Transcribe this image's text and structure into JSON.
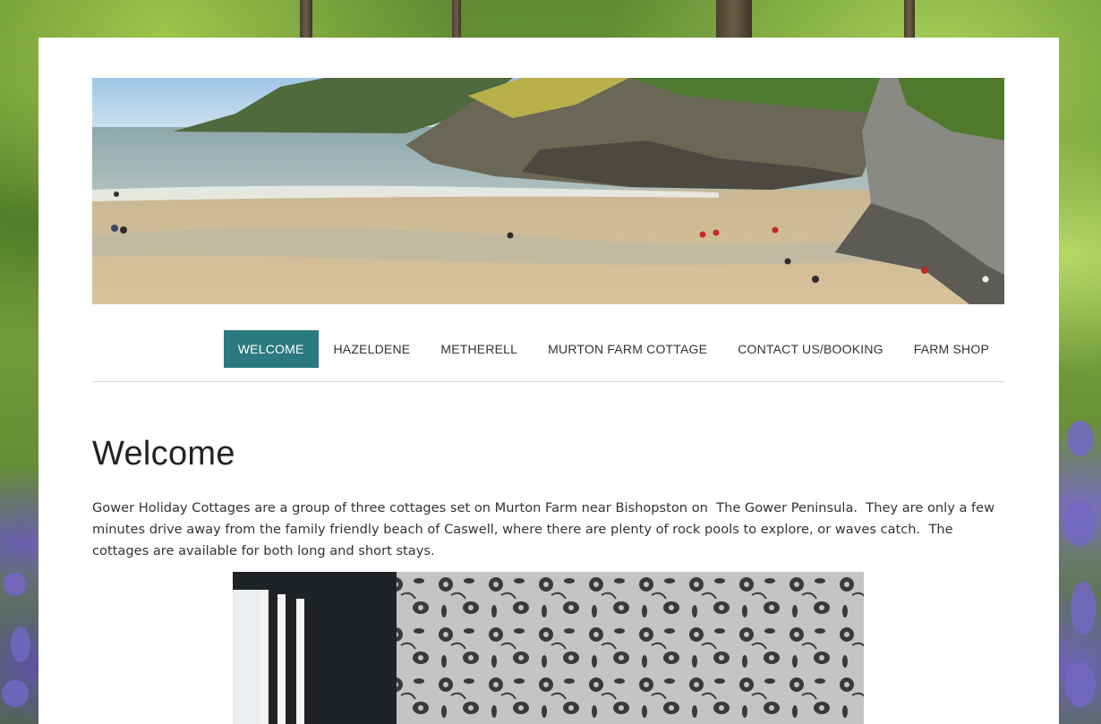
{
  "background": {
    "description_icon": "forest-bluebells-background",
    "colors": {
      "foliage": "#77a23d",
      "bluebells": "#7366c4"
    }
  },
  "banner": {
    "icon": "beach-cliffs-banner-photo"
  },
  "nav": {
    "items": [
      {
        "label": "WELCOME",
        "active": true
      },
      {
        "label": "HAZELDENE",
        "active": false
      },
      {
        "label": "METHERELL",
        "active": false
      },
      {
        "label": "MURTON FARM COTTAGE",
        "active": false
      },
      {
        "label": "CONTACT US/BOOKING",
        "active": false
      },
      {
        "label": "FARM SHOP",
        "active": false
      }
    ],
    "active_color": "#2a7a80"
  },
  "main": {
    "title": "Welcome",
    "intro": "Gower Holiday Cottages are a group of three cottages set on Murton Farm near Bishopston on  The Gower Peninsula.  They are only a few minutes drive away from the family friendly beach of Caswell, where there are plenty of rock pools to explore, or waves catch.  The cottages are available for both long and short stays.",
    "photo_icon": "bedroom-floral-wallpaper-photo"
  }
}
